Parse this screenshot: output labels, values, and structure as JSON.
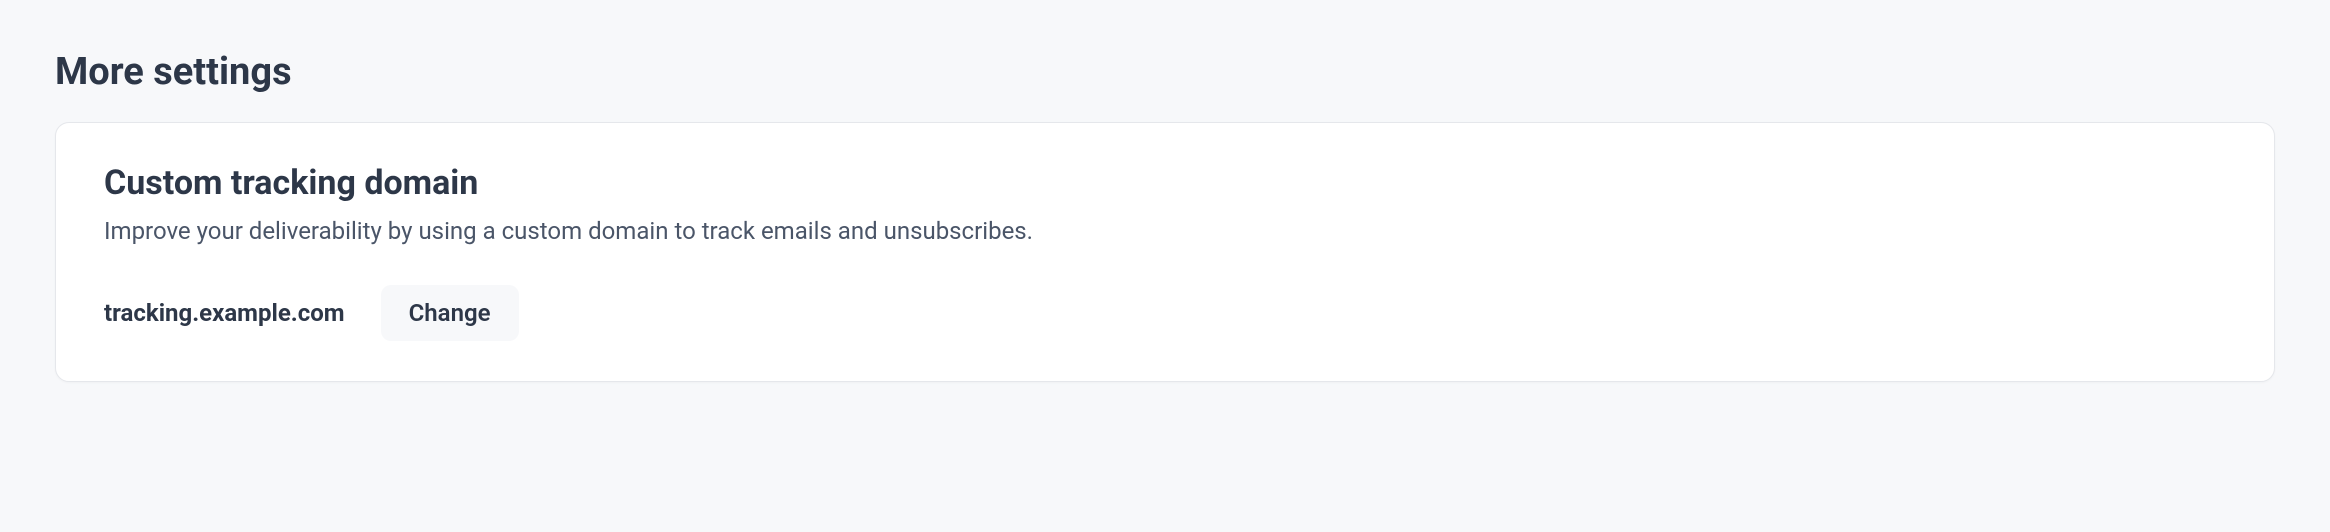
{
  "section": {
    "title": "More settings"
  },
  "card": {
    "title": "Custom tracking domain",
    "description": "Improve your deliverability by using a custom domain to track emails and unsubscribes.",
    "domain_value": "tracking.example.com",
    "change_label": "Change"
  }
}
